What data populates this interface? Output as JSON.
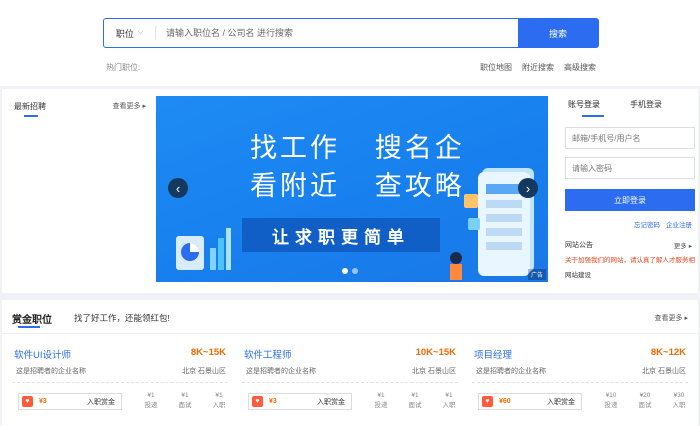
{
  "search": {
    "category": "职位",
    "placeholder": "请输入职位名 / 公司名 进行搜索",
    "button": "搜索",
    "hot_label": "热门职位:"
  },
  "quick_links": [
    "职位地图",
    "附近搜索",
    "高级搜索"
  ],
  "news": {
    "title": "最新招聘",
    "more": "查看更多"
  },
  "carousel": {
    "line1": [
      "找工作",
      "搜名企"
    ],
    "line2": [
      "看附近",
      "查攻略"
    ],
    "cta": "让求职更简单",
    "prev": "‹",
    "next": "›",
    "slides": 2,
    "active_slide": 0,
    "ad_tag": "广告"
  },
  "login": {
    "tabs": [
      "账号登录",
      "手机登录"
    ],
    "user_placeholder": "邮箱/手机号/用户名",
    "pass_placeholder": "请输入密码",
    "submit": "立即登录",
    "links": [
      "忘记密码",
      "企业注册"
    ],
    "notice_title": "网站公告",
    "notice_more": "更多",
    "notice_items": [
      "关于加强我们的网站，请认真了解人才服务相关事项",
      "网站建设"
    ]
  },
  "jobs": {
    "title": "赏金职位",
    "subtitle": "找了好工作，还能领红包!",
    "more": "查看更多",
    "stat_labels": [
      "投递",
      "面试",
      "入职"
    ],
    "reward_label": "入职赏金",
    "items": [
      {
        "title": "软件UI设计师",
        "salary": "8K~15K",
        "company": "这是招聘者的企业名称",
        "location": "北京 石景山区",
        "reward": "¥3",
        "stats": [
          "¥1",
          "¥1",
          "¥1"
        ]
      },
      {
        "title": "软件工程师",
        "salary": "10K~15K",
        "company": "这是招聘者的企业名称",
        "location": "北京 石景山区",
        "reward": "¥3",
        "stats": [
          "¥1",
          "¥1",
          "¥1"
        ]
      },
      {
        "title": "项目经理",
        "salary": "8K~12K",
        "company": "这是招聘者的企业名称",
        "location": "北京 石景山区",
        "reward": "¥60",
        "stats": [
          "¥10",
          "¥20",
          "¥30"
        ]
      }
    ]
  },
  "colors": {
    "primary": "#2b6cf0",
    "salary": "#f06a00",
    "notice": "#e8451d"
  }
}
